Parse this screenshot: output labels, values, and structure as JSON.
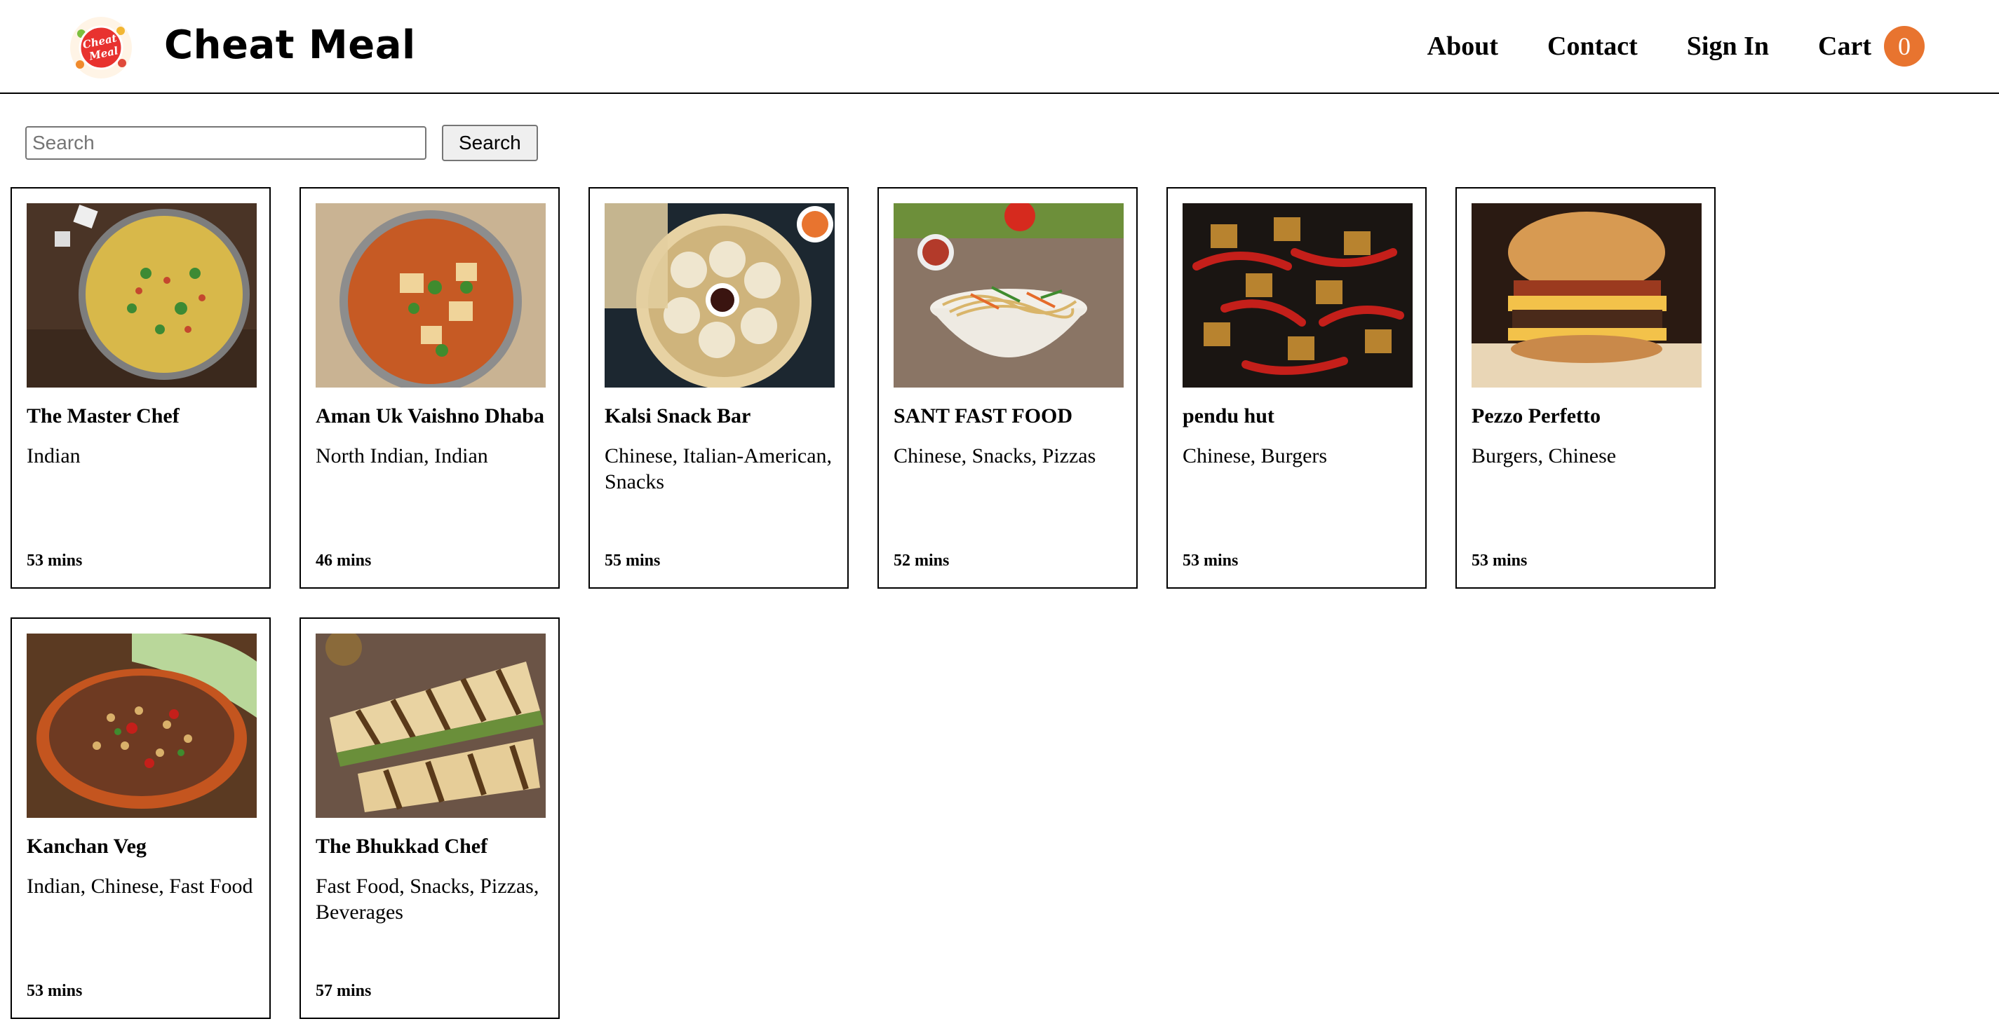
{
  "header": {
    "brand": "Cheat Meal",
    "logo_text": "Cheat Meal",
    "nav": {
      "about": "About",
      "contact": "Contact",
      "sign_in": "Sign In",
      "cart": "Cart",
      "cart_count": "0"
    }
  },
  "search": {
    "placeholder": "Search",
    "button_label": "Search",
    "value": ""
  },
  "colors": {
    "accent": "#e8742f",
    "border": "#000000",
    "background": "#ffffff"
  },
  "restaurants": [
    {
      "name": "The Master Chef",
      "cuisines": "Indian",
      "time": "53 mins",
      "image": "egg-bhurji-pan"
    },
    {
      "name": "Aman Uk Vaishno Dhaba",
      "cuisines": "North Indian, Indian",
      "time": "46 mins",
      "image": "paneer-curry"
    },
    {
      "name": "Kalsi Snack Bar",
      "cuisines": "Chinese, Italian-American, Snacks",
      "time": "55 mins",
      "image": "momos-basket"
    },
    {
      "name": "SANT FAST FOOD",
      "cuisines": "Chinese, Snacks, Pizzas",
      "time": "52 mins",
      "image": "noodles-bowl"
    },
    {
      "name": "pendu hut",
      "cuisines": "Chinese, Burgers",
      "time": "53 mins",
      "image": "chilli-paneer"
    },
    {
      "name": "Pezzo Perfetto",
      "cuisines": "Burgers, Chinese",
      "time": "53 mins",
      "image": "cheeseburger"
    },
    {
      "name": "Kanchan Veg",
      "cuisines": "Indian, Chinese, Fast Food",
      "time": "53 mins",
      "image": "bhel-puri"
    },
    {
      "name": "The Bhukkad Chef",
      "cuisines": "Fast Food, Snacks, Pizzas, Beverages",
      "time": "57 mins",
      "image": "grilled-sandwich"
    }
  ]
}
